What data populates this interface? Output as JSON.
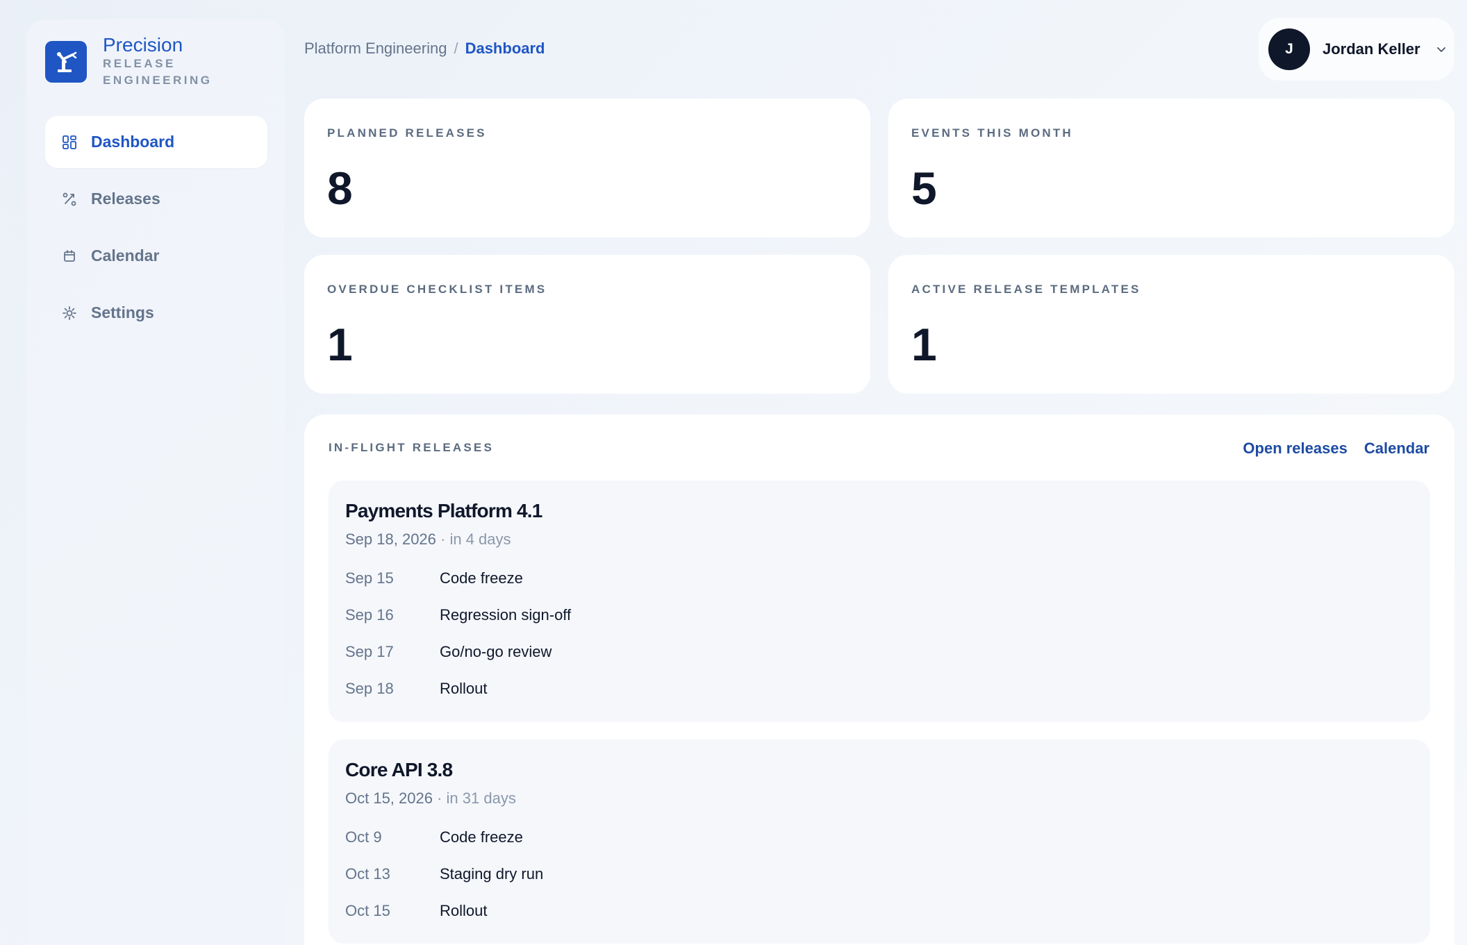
{
  "brand": {
    "name": "Precision",
    "subtitle": "RELEASE ENGINEERING",
    "logo_icon": "robot-arm-icon",
    "color": "#1f56c4"
  },
  "sidebar": {
    "items": [
      {
        "label": "Dashboard",
        "icon": "dashboard-grid-icon",
        "active": true
      },
      {
        "label": "Releases",
        "icon": "releases-path-icon",
        "active": false
      },
      {
        "label": "Calendar",
        "icon": "calendar-icon",
        "active": false
      },
      {
        "label": "Settings",
        "icon": "gear-icon",
        "active": false
      }
    ]
  },
  "header": {
    "breadcrumb": {
      "parent": "Platform Engineering",
      "separator": "/",
      "current": "Dashboard"
    },
    "user": {
      "initial": "J",
      "name": "Jordan Keller",
      "menu_icon": "chevron-down-icon"
    }
  },
  "stats": [
    {
      "label": "PLANNED RELEASES",
      "value": "8"
    },
    {
      "label": "EVENTS THIS MONTH",
      "value": "5"
    },
    {
      "label": "OVERDUE CHECKLIST ITEMS",
      "value": "1"
    },
    {
      "label": "ACTIVE RELEASE TEMPLATES",
      "value": "1"
    }
  ],
  "inflight": {
    "title": "IN-FLIGHT RELEASES",
    "links": {
      "open_releases": "Open releases",
      "calendar": "Calendar"
    },
    "releases": [
      {
        "name": "Payments Platform 4.1",
        "date": "Sep 18, 2026",
        "relative": " · in 4 days",
        "milestones": [
          {
            "date": "Sep 15",
            "name": "Code freeze"
          },
          {
            "date": "Sep 16",
            "name": "Regression sign-off"
          },
          {
            "date": "Sep 17",
            "name": "Go/no-go review"
          },
          {
            "date": "Sep 18",
            "name": "Rollout"
          }
        ]
      },
      {
        "name": "Core API 3.8",
        "date": "Oct 15, 2026",
        "relative": " · in 31 days",
        "milestones": [
          {
            "date": "Oct 9",
            "name": "Code freeze"
          },
          {
            "date": "Oct 13",
            "name": "Staging dry run"
          },
          {
            "date": "Oct 15",
            "name": "Rollout"
          }
        ]
      }
    ]
  },
  "colors": {
    "accent": "#1f56c4",
    "link": "#1d4ba3",
    "text_dark": "#0f172a",
    "text_muted": "#64748b"
  }
}
